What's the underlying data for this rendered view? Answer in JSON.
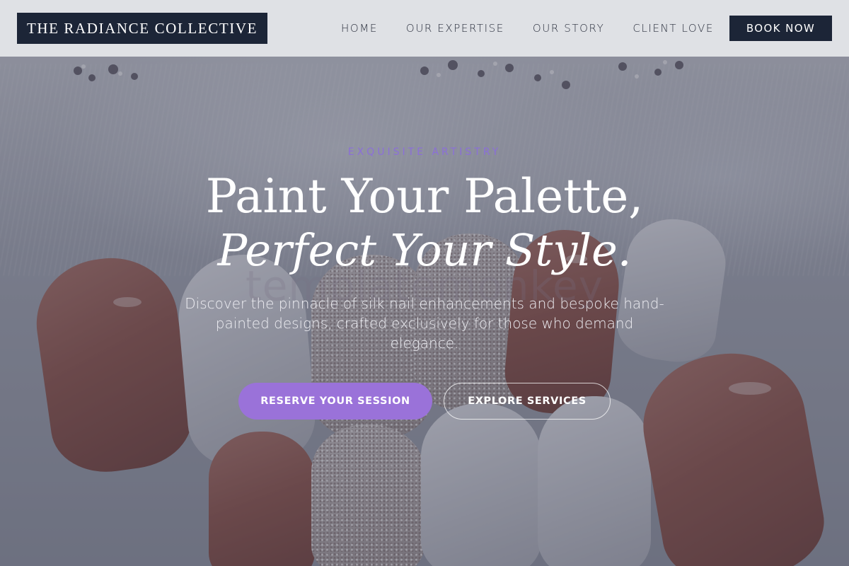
{
  "brand": {
    "name": "THE RADIANCE COLLECTIVE"
  },
  "nav": {
    "items": [
      {
        "label": "HOME"
      },
      {
        "label": "OUR EXPERTISE"
      },
      {
        "label": "OUR STORY"
      },
      {
        "label": "CLIENT LOVE"
      }
    ],
    "cta_label": "BOOK NOW"
  },
  "hero": {
    "eyebrow": "EXQUISITE ARTISTRY",
    "headline_line1": "Paint Your Palette,",
    "headline_line2": "Perfect Your Style.",
    "subtitle": "Discover the pinnacle of silk nail enhancements and bespoke hand-painted designs, crafted exclusively for those who demand elegance.",
    "watermark": "templatemonkey",
    "primary_button": "RESERVE YOUR SESSION",
    "secondary_button": "EXPLORE SERVICES"
  },
  "colors": {
    "navy": "#1c2537",
    "accent": "#9a72d9",
    "eyebrow": "#8b6fd8",
    "header_bg": "#e2e4e8"
  }
}
